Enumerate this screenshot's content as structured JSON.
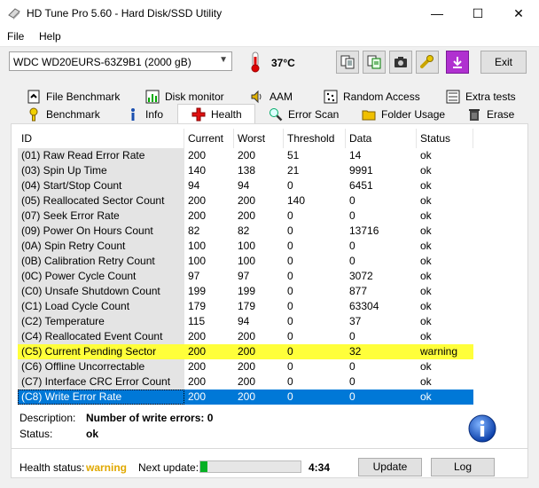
{
  "window": {
    "title": "HD Tune Pro 5.60 - Hard Disk/SSD Utility",
    "minimize": "—",
    "maximize": "☐",
    "close": "✕"
  },
  "menu": {
    "file": "File",
    "help": "Help"
  },
  "toolbar": {
    "drive": "WDC WD20EURS-63Z9B1 (2000 gB)",
    "temperature": "37°C",
    "exit": "Exit"
  },
  "tabs_row1": [
    {
      "label": "File Benchmark",
      "icon": "file-benchmark-icon"
    },
    {
      "label": "Disk monitor",
      "icon": "disk-monitor-icon"
    },
    {
      "label": "AAM",
      "icon": "speaker-icon"
    },
    {
      "label": "Random Access",
      "icon": "random-access-icon"
    },
    {
      "label": "Extra tests",
      "icon": "extra-tests-icon"
    }
  ],
  "tabs_row2": [
    {
      "label": "Benchmark",
      "icon": "benchmark-icon"
    },
    {
      "label": "Info",
      "icon": "info-small-icon"
    },
    {
      "label": "Health",
      "icon": "health-cross-icon",
      "active": true
    },
    {
      "label": "Error Scan",
      "icon": "magnifier-icon"
    },
    {
      "label": "Folder Usage",
      "icon": "folder-icon"
    },
    {
      "label": "Erase",
      "icon": "trash-icon"
    }
  ],
  "table": {
    "headers": [
      "ID",
      "Current",
      "Worst",
      "Threshold",
      "Data",
      "Status"
    ],
    "rows": [
      [
        "(01) Raw Read Error Rate",
        "200",
        "200",
        "51",
        "14",
        "ok"
      ],
      [
        "(03) Spin Up Time",
        "140",
        "138",
        "21",
        "9991",
        "ok"
      ],
      [
        "(04) Start/Stop Count",
        "94",
        "94",
        "0",
        "6451",
        "ok"
      ],
      [
        "(05) Reallocated Sector Count",
        "200",
        "200",
        "140",
        "0",
        "ok"
      ],
      [
        "(07) Seek Error Rate",
        "200",
        "200",
        "0",
        "0",
        "ok"
      ],
      [
        "(09) Power On Hours Count",
        "82",
        "82",
        "0",
        "13716",
        "ok"
      ],
      [
        "(0A) Spin Retry Count",
        "100",
        "100",
        "0",
        "0",
        "ok"
      ],
      [
        "(0B) Calibration Retry Count",
        "100",
        "100",
        "0",
        "0",
        "ok"
      ],
      [
        "(0C) Power Cycle Count",
        "97",
        "97",
        "0",
        "3072",
        "ok"
      ],
      [
        "(C0) Unsafe Shutdown Count",
        "199",
        "199",
        "0",
        "877",
        "ok"
      ],
      [
        "(C1) Load Cycle Count",
        "179",
        "179",
        "0",
        "63304",
        "ok"
      ],
      [
        "(C2) Temperature",
        "115",
        "94",
        "0",
        "37",
        "ok"
      ],
      [
        "(C4) Reallocated Event Count",
        "200",
        "200",
        "0",
        "0",
        "ok"
      ],
      [
        "(C5) Current Pending Sector",
        "200",
        "200",
        "0",
        "32",
        "warning"
      ],
      [
        "(C6) Offline Uncorrectable",
        "200",
        "200",
        "0",
        "0",
        "ok"
      ],
      [
        "(C7) Interface CRC Error Count",
        "200",
        "200",
        "0",
        "0",
        "ok"
      ],
      [
        "(C8) Write Error Rate",
        "200",
        "200",
        "0",
        "0",
        "ok"
      ]
    ]
  },
  "details": {
    "description_label": "Description:",
    "description_value": "Number of write errors: 0",
    "status_label": "Status:",
    "status_value": "ok"
  },
  "footer": {
    "health_label": "Health status:",
    "health_value": "warning",
    "health_color": "#e0a800",
    "next_update_label": "Next update:",
    "progress_percent": 7,
    "countdown": "4:34",
    "update_button": "Update",
    "log_button": "Log"
  }
}
